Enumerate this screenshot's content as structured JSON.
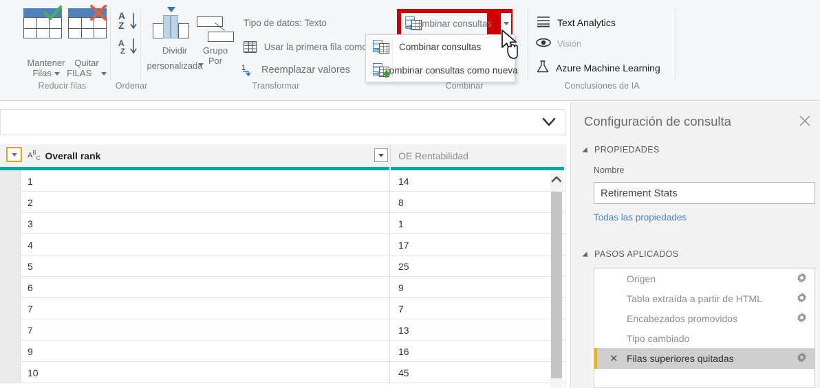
{
  "ribbon": {
    "groups": [
      {
        "caption": "Reducir filas"
      },
      {
        "caption": "Ordenar"
      },
      {
        "caption": "Transformar"
      },
      {
        "caption": "Combinar"
      },
      {
        "caption": "Conclusiones de IA"
      }
    ],
    "reduce_rows": {
      "keep_rows_label_top": "Mantener",
      "keep_rows_label_bottom": "Filas",
      "remove_rows_label_top": "Quitar",
      "remove_rows_label_bottom": "FILAS",
      "keep_icon": "keep-rows-icon",
      "remove_icon": "remove-rows-icon"
    },
    "sort": {
      "asc_icon": "sort-ascending-icon",
      "desc_icon": "sort-descending-icon",
      "asc_label": "A Z",
      "desc_label": "A Z"
    },
    "split_column": {
      "line1": "Dividir",
      "line2": "personalizada",
      "icon": "split-column-icon"
    },
    "group_by": {
      "line1": "Grupo",
      "line2": "Por",
      "icon": "group-by-icon"
    },
    "transform": {
      "data_type": "Tipo de datos: Texto",
      "first_row_headers": "Usar la primera fila como",
      "replace_values": "Reemplazar valores",
      "first_row_icon": "table-header-icon",
      "replace_icon": "replace-values-icon"
    },
    "combine": {
      "button_label": "Combinar consultas",
      "button_icon": "merge-queries-icon",
      "dropdown_icon": "caret-down-icon",
      "menu_items": [
        {
          "label": "Combinar consultas",
          "icon": "merge-queries-icon"
        },
        {
          "label": "Combinar consultas como nueva",
          "icon": "merge-queries-new-icon"
        }
      ],
      "highlight_color": "#d00000"
    },
    "ai_insights": {
      "items": [
        {
          "label": "Text Analytics",
          "icon": "text-analytics-icon",
          "enabled": true
        },
        {
          "label": "Visión",
          "icon": "vision-eye-icon",
          "enabled": false
        },
        {
          "label": "Azure Machine Learning",
          "icon": "flask-icon",
          "enabled": true
        }
      ]
    }
  },
  "formula_bar": {
    "value": "",
    "expand_icon": "chevron-down-icon"
  },
  "grid": {
    "columns": [
      {
        "name": "Overall rank",
        "type_glyph": "ABC",
        "type_icon": "text-type-icon"
      },
      {
        "name": "OE Rentabilidad",
        "type_glyph": "",
        "type_icon": ""
      }
    ],
    "rows": [
      {
        "overall_rank": "1",
        "oe_rentabilidad": "14"
      },
      {
        "overall_rank": "2",
        "oe_rentabilidad": "8"
      },
      {
        "overall_rank": "3",
        "oe_rentabilidad": "1"
      },
      {
        "overall_rank": "4",
        "oe_rentabilidad": "17"
      },
      {
        "overall_rank": "5",
        "oe_rentabilidad": "25"
      },
      {
        "overall_rank": "6",
        "oe_rentabilidad": "9"
      },
      {
        "overall_rank": "7",
        "oe_rentabilidad": "7"
      },
      {
        "overall_rank": "7",
        "oe_rentabilidad": "13"
      },
      {
        "overall_rank": "9",
        "oe_rentabilidad": "16"
      },
      {
        "overall_rank": "10",
        "oe_rentabilidad": "45"
      }
    ],
    "select_all_icon": "caret-down-icon",
    "accent_color": "#0fa6a2",
    "selection_color": "#e0a90a",
    "scroll_up_icon": "chevron-up-icon"
  },
  "query_settings": {
    "title": "Configuración de consulta",
    "close_icon": "close-icon",
    "properties_header": "PROPIEDADES",
    "name_label": "Nombre",
    "name_value": "Retirement Stats",
    "all_properties_link": "Todas las propiedades",
    "applied_steps_header": "PASOS APLICADOS",
    "steps": [
      {
        "label": "Origen",
        "active": false,
        "has_gear": true,
        "has_delete": false
      },
      {
        "label": "Tabla extraída a partir de HTML",
        "active": false,
        "has_gear": true,
        "has_delete": false
      },
      {
        "label": "Encabezados promovidos",
        "active": false,
        "has_gear": true,
        "has_delete": false
      },
      {
        "label": "Tipo cambiado",
        "active": false,
        "has_gear": false,
        "has_delete": false
      },
      {
        "label": "Filas superiores quitadas",
        "active": true,
        "has_gear": true,
        "has_delete": true
      }
    ],
    "gear_icon": "gear-icon",
    "delete_step_icon": "close-x-icon"
  }
}
